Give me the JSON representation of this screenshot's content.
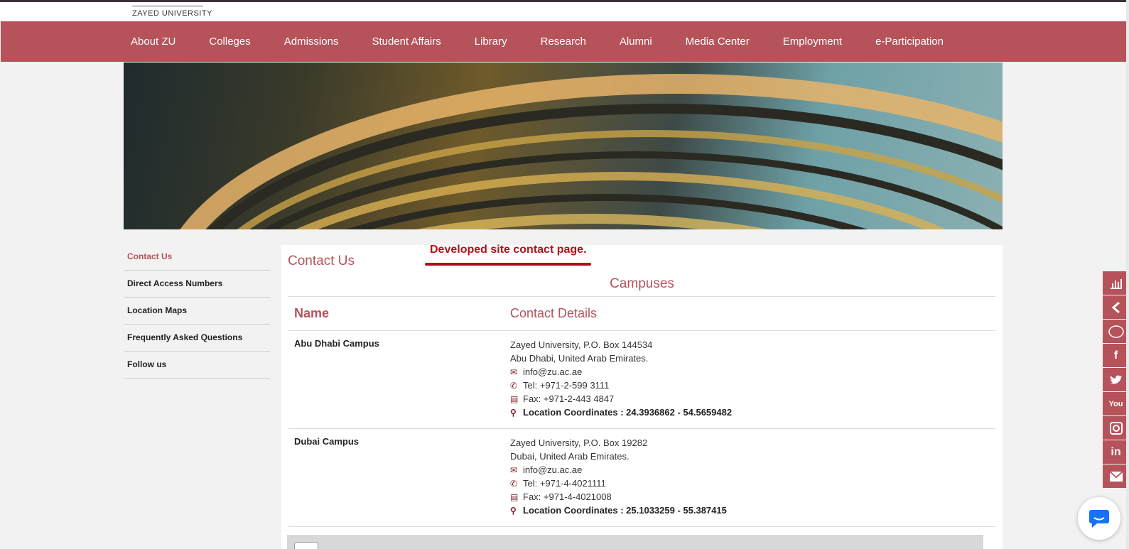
{
  "header": {
    "university_name": "ZAYED UNIVERSITY"
  },
  "nav": {
    "items": [
      "About ZU",
      "Colleges",
      "Admissions",
      "Student Affairs",
      "Library",
      "Research",
      "Alumni",
      "Media Center",
      "Employment",
      "e-Participation"
    ]
  },
  "sidebar": {
    "items": [
      {
        "label": "Contact Us",
        "active": true
      },
      {
        "label": "Direct Access Numbers",
        "active": false
      },
      {
        "label": "Location Maps",
        "active": false
      },
      {
        "label": "Frequently Asked Questions",
        "active": false
      },
      {
        "label": "Follow us",
        "active": false
      }
    ]
  },
  "main": {
    "title": "Contact Us",
    "annotation": "Developed site contact page.",
    "section_title": "Campuses",
    "table": {
      "headers": [
        "Name",
        "Contact Details"
      ],
      "rows": [
        {
          "name": "Abu Dhabi Campus",
          "address1": "Zayed University, P.O. Box 144534",
          "address2": "Abu Dhabi, United Arab Emirates.",
          "email": "info@zu.ac.ae",
          "tel": "Tel: +971-2-599 3111",
          "fax": "Fax: +971-2-443 4847",
          "coords": "Location Coordinates : 24.3936862 - 54.5659482"
        },
        {
          "name": "Dubai Campus",
          "address1": "Zayed University, P.O. Box 19282",
          "address2": "Dubai, United Arab Emirates.",
          "email": "info@zu.ac.ae",
          "tel": "Tel: +971-4-4021111",
          "fax": "Fax: +971-4-4021008",
          "coords": "Location Coordinates : 25.1033259 - 55.387415"
        }
      ]
    }
  },
  "social": {
    "items": [
      "chart-icon",
      "chevron-left-icon",
      "circle-icon",
      "facebook-icon",
      "twitter-icon",
      "youtube-icon",
      "instagram-icon",
      "linkedin-icon",
      "envelope-icon"
    ]
  },
  "colors": {
    "brand": "#b5525a",
    "annotation": "#b1101a",
    "icon": "#7a1f26"
  }
}
